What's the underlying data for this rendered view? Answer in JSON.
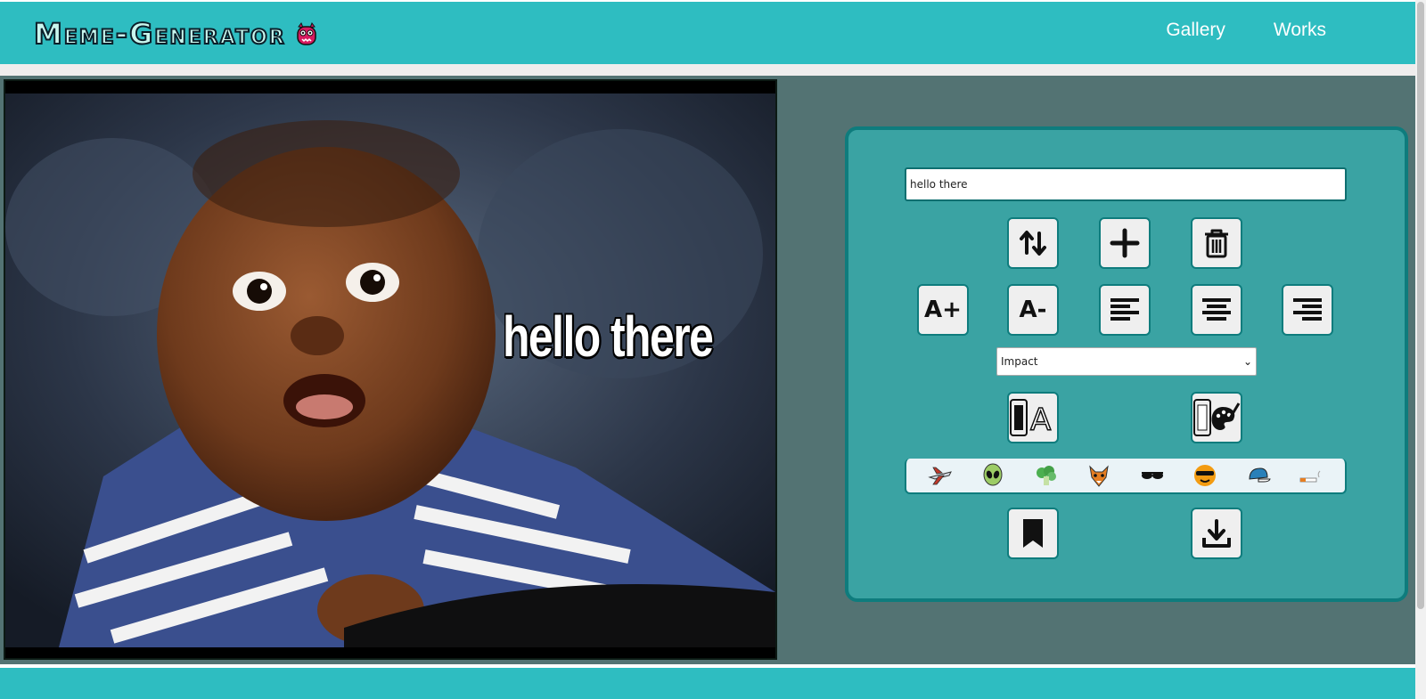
{
  "header": {
    "logo_text": "Meme-Generator",
    "nav": [
      {
        "label": "Gallery"
      },
      {
        "label": "Works"
      }
    ]
  },
  "canvas": {
    "meme_text": "hello there"
  },
  "editor": {
    "text_input_value": "hello there",
    "font_select_value": "Impact",
    "font_size_increase_label": "A+",
    "font_size_decrease_label": "A-",
    "stickers": [
      "airplane",
      "alien",
      "broccoli",
      "fox",
      "sunglasses",
      "cool-face",
      "cap",
      "cigarette"
    ]
  },
  "colors": {
    "header": "#2ebdc1",
    "main_bg": "#537373",
    "editor_bg": "#3aa3a3",
    "editor_border": "#0e7c7d"
  }
}
